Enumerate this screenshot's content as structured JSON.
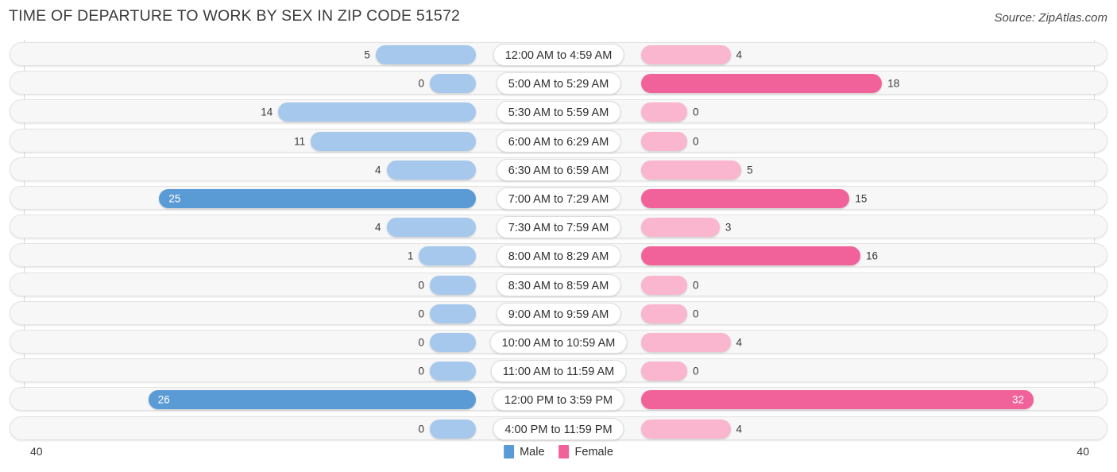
{
  "header": {
    "title": "TIME OF DEPARTURE TO WORK BY SEX IN ZIP CODE 51572",
    "source": "Source: ZipAtlas.com"
  },
  "axis": {
    "left_label": "40",
    "right_label": "40"
  },
  "legend": [
    {
      "label": "Male",
      "color": "#5B9BD5"
    },
    {
      "label": "Female",
      "color": "#F2629A"
    }
  ],
  "colors": {
    "male_strong": "#5B9BD5",
    "male_light": "#A5C8EC",
    "female_strong": "#F2629A",
    "female_light": "#F9B6CE",
    "track": "#f7f7f7",
    "track_border": "#e3e3e3",
    "gridline": "#d8d8d8"
  },
  "chart_data": {
    "type": "bar",
    "title": "TIME OF DEPARTURE TO WORK BY SEX IN ZIP CODE 51572",
    "subtitle": "",
    "orientation": "horizontal-diverging",
    "xlabel": "",
    "ylabel": "",
    "xlim": [
      40,
      40
    ],
    "axis_max": 40,
    "grid": true,
    "legend_position": "bottom-center",
    "categories": [
      "12:00 AM to 4:59 AM",
      "5:00 AM to 5:29 AM",
      "5:30 AM to 5:59 AM",
      "6:00 AM to 6:29 AM",
      "6:30 AM to 6:59 AM",
      "7:00 AM to 7:29 AM",
      "7:30 AM to 7:59 AM",
      "8:00 AM to 8:29 AM",
      "8:30 AM to 8:59 AM",
      "9:00 AM to 9:59 AM",
      "10:00 AM to 10:59 AM",
      "11:00 AM to 11:59 AM",
      "12:00 PM to 3:59 PM",
      "4:00 PM to 11:59 PM"
    ],
    "series": [
      {
        "name": "Male",
        "color": "#5B9BD5",
        "values": [
          5,
          0,
          14,
          11,
          4,
          25,
          4,
          1,
          0,
          0,
          0,
          0,
          26,
          0
        ]
      },
      {
        "name": "Female",
        "color": "#F2629A",
        "values": [
          4,
          18,
          0,
          0,
          5,
          15,
          3,
          16,
          0,
          0,
          4,
          0,
          32,
          4
        ]
      }
    ]
  }
}
